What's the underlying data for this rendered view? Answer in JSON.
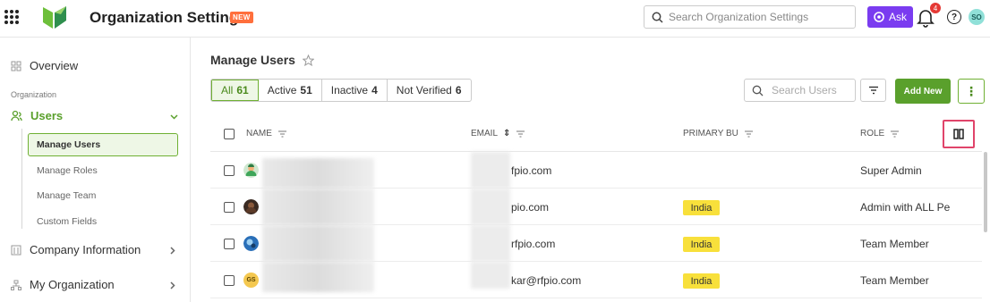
{
  "header": {
    "title": "Organization Settings",
    "new_badge": "NEW",
    "search_placeholder": "Search Organization Settings",
    "ask_label": "Ask",
    "notification_count": "4",
    "help_glyph": "?",
    "user_initials": "SO"
  },
  "sidebar": {
    "overview": "Overview",
    "group_label": "Organization",
    "users": "Users",
    "sub_items": [
      "Manage Users",
      "Manage Roles",
      "Manage Team",
      "Custom Fields"
    ],
    "company_information": "Company Information",
    "my_organization": "My Organization"
  },
  "main": {
    "page_title": "Manage Users",
    "filters": [
      {
        "label": "All",
        "count": "61"
      },
      {
        "label": "Active",
        "count": "51"
      },
      {
        "label": "Inactive",
        "count": "4"
      },
      {
        "label": "Not Verified",
        "count": "6"
      }
    ],
    "search_placeholder": "Search Users",
    "add_button": "Add New",
    "more_glyph": "⋮"
  },
  "table": {
    "columns": {
      "name": "NAME",
      "email": "EMAIL",
      "primary_bu": "PRIMARY BU",
      "role": "ROLE"
    },
    "sort_glyph": "⇕",
    "rows": [
      {
        "avatar": "avatar-green",
        "email": "fpio.com",
        "bu": "",
        "role": "Super Admin"
      },
      {
        "avatar": "avatar-dark",
        "email": "pio.com",
        "bu": "India",
        "role": "Admin with ALL Pe"
      },
      {
        "avatar": "avatar-globe",
        "email": "rfpio.com",
        "bu": "India",
        "role": "Team Member"
      },
      {
        "avatar": "GS",
        "email": "kar@rfpio.com",
        "bu": "India",
        "role": "Team Member"
      }
    ]
  },
  "colors": {
    "brand_green": "#5aa02c",
    "ask_purple": "#7a3cf0",
    "highlight_pink": "#e0446a",
    "bu_yellow": "#f8e03b"
  }
}
